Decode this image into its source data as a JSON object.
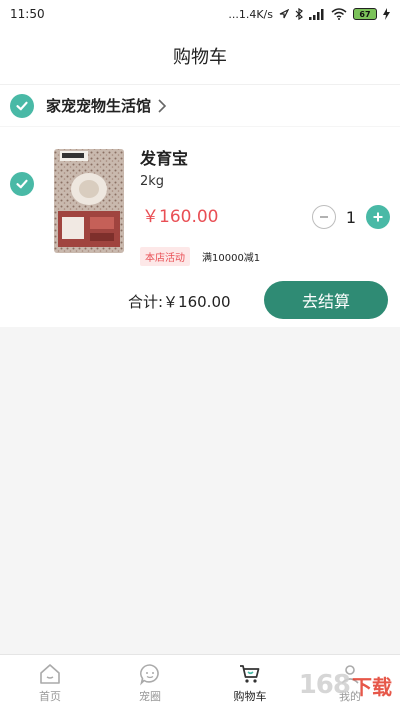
{
  "status_bar": {
    "time": "11:50",
    "network_speed": "...1.4K/s",
    "battery": "67"
  },
  "header": {
    "title": "购物车"
  },
  "store": {
    "name": "家宠宠物生活馆",
    "checked": true
  },
  "item": {
    "name": "发育宝",
    "spec": "2kg",
    "price": "￥160.00",
    "quantity": "1",
    "promo_tag": "本店活动",
    "promo_text": "满10000减1",
    "checked": true
  },
  "summary": {
    "total": "合计:￥160.00",
    "checkout_label": "去结算"
  },
  "bottom_nav": {
    "items": [
      {
        "label": "首页",
        "icon": "home-icon",
        "active": false
      },
      {
        "label": "宠圈",
        "icon": "pet-circle-icon",
        "active": false
      },
      {
        "label": "购物车",
        "icon": "cart-icon",
        "active": true
      },
      {
        "label": "我的",
        "icon": "profile-icon",
        "active": false
      }
    ]
  },
  "watermark": {
    "number": "168",
    "text": "下载"
  },
  "colors": {
    "accent": "#49b9a6",
    "checkout": "#2f8b74",
    "price": "#e94f55"
  }
}
